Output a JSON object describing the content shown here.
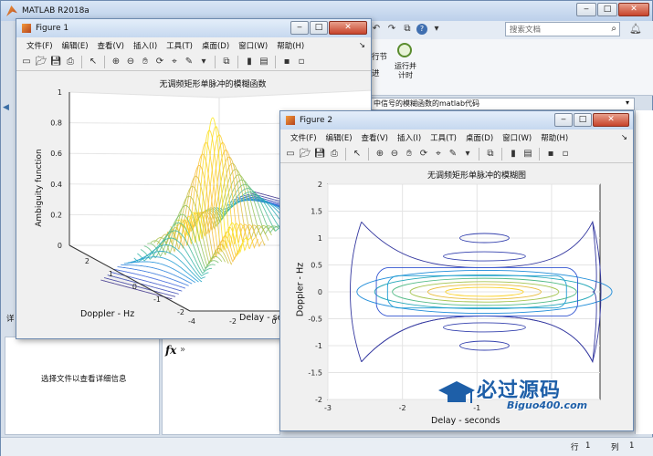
{
  "main": {
    "title": "MATLAB R2018a",
    "search_placeholder": "搜索文档",
    "tb_a": "行节",
    "tb_b": "进",
    "tb_run_time": "运行并\n计时",
    "path_text": "中信号的模糊函数的matlab代码",
    "details": "选择文件以查看详细信息",
    "panel_label": "详",
    "fx": "fx",
    "chev": "»",
    "status_row": "行",
    "status_row_val": "1",
    "status_col": "列",
    "status_col_val": "1"
  },
  "fig1": {
    "title": "Figure 1",
    "menus": [
      "文件(F)",
      "编辑(E)",
      "查看(V)",
      "插入(I)",
      "工具(T)",
      "桌面(D)",
      "窗口(W)",
      "帮助(H)"
    ],
    "plot_title": "无调频矩形单脉冲的模糊函数",
    "zlabel": "Ambiguity function",
    "xlabel": "Doppler - Hz",
    "ylabel": "Delay - se",
    "zticks": [
      "1",
      "0.8",
      "0.6",
      "0.4",
      "0.2",
      "0"
    ],
    "xticks": [
      "2",
      "1",
      "0",
      "-1",
      "-2"
    ],
    "yticks": [
      "-4",
      "-2",
      "0"
    ]
  },
  "fig2": {
    "title": "Figure 2",
    "menus": [
      "文件(F)",
      "编辑(E)",
      "查看(V)",
      "插入(I)",
      "工具(T)",
      "桌面(D)",
      "窗口(W)",
      "帮助(H)"
    ],
    "plot_title": "无调频矩形单脉冲的模糊图",
    "xlabel": "Delay - seconds",
    "ylabel": "Doppler - Hz",
    "yticks": [
      "2",
      "1.5",
      "1",
      "0.5",
      "0",
      "-0.5",
      "-1",
      "-1.5",
      "-2"
    ],
    "xticks": [
      "-3",
      "-2",
      "-1"
    ]
  },
  "watermark": {
    "text": "必过源码",
    "url": "Biguo400.com"
  }
}
